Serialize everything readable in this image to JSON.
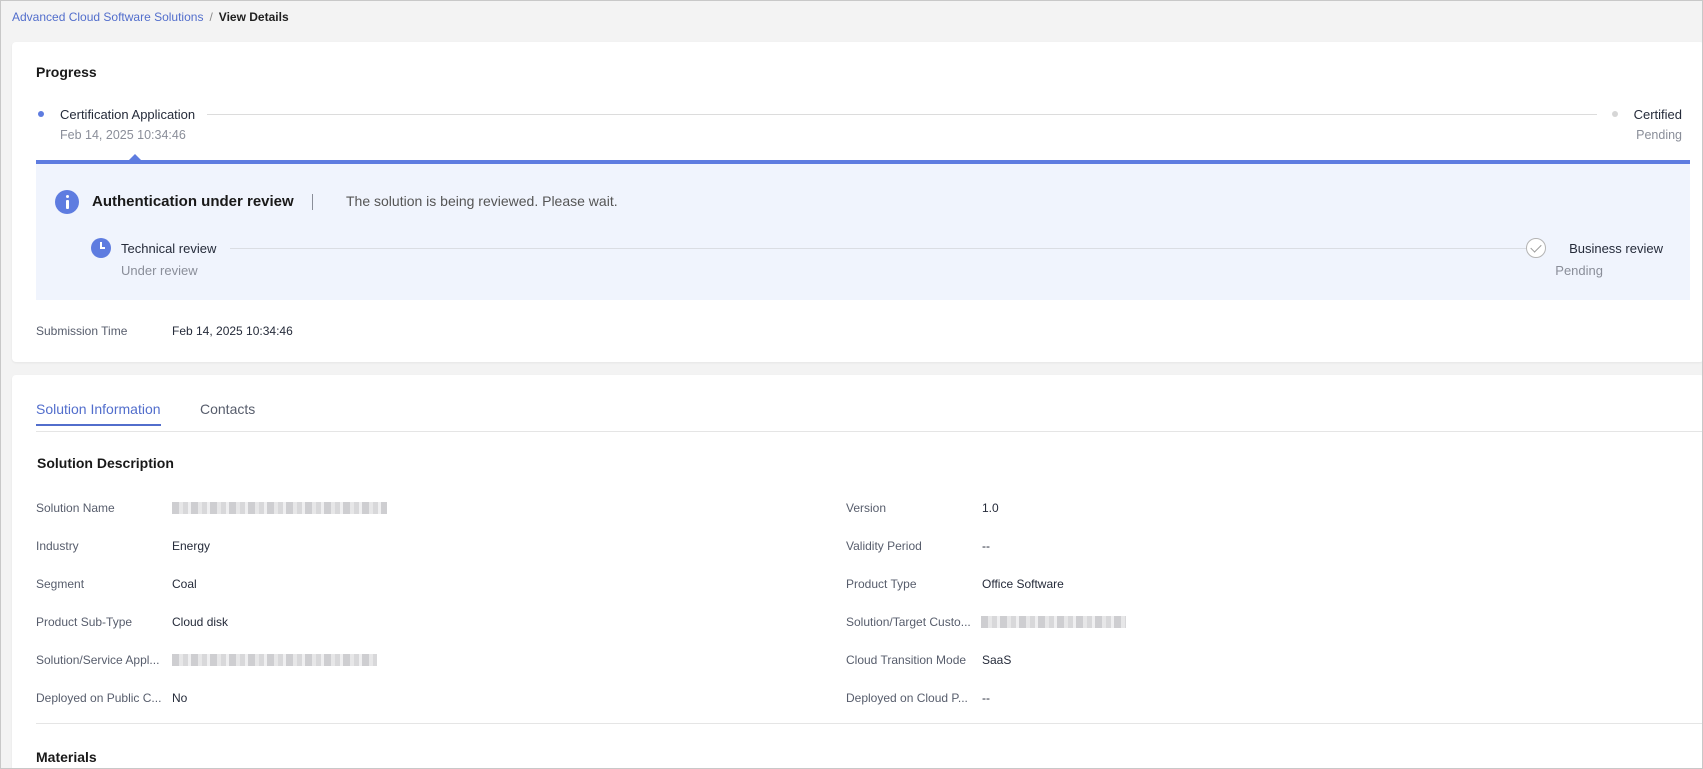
{
  "breadcrumb": {
    "parent": "Advanced Cloud Software Solutions",
    "separator": "/",
    "current": "View Details"
  },
  "progress": {
    "title": "Progress",
    "steps": [
      {
        "title": "Certification Application",
        "subtitle": "Feb 14, 2025 10:34:46",
        "state": "active"
      },
      {
        "title": "Certified",
        "subtitle": "Pending",
        "state": "pending"
      }
    ],
    "review": {
      "title": "Authentication under review",
      "message": "The solution is being reviewed. Please wait.",
      "substeps": [
        {
          "title": "Technical review",
          "status": "Under review"
        },
        {
          "title": "Business review",
          "status": "Pending"
        }
      ]
    },
    "submission_time_label": "Submission Time",
    "submission_time_value": "Feb 14, 2025 10:34:46"
  },
  "tabs": [
    {
      "label": "Solution Information",
      "active": true
    },
    {
      "label": "Contacts",
      "active": false
    }
  ],
  "solution_description": {
    "title": "Solution Description",
    "left": [
      {
        "label": "Solution Name",
        "value": ""
      },
      {
        "label": "Industry",
        "value": "Energy"
      },
      {
        "label": "Segment",
        "value": "Coal"
      },
      {
        "label": "Product Sub-Type",
        "value": "Cloud disk"
      },
      {
        "label": "Solution/Service Appl...",
        "value": ""
      },
      {
        "label": "Deployed on Public C...",
        "value": "No"
      }
    ],
    "right": [
      {
        "label": "Version",
        "value": "1.0"
      },
      {
        "label": "Validity Period",
        "value": "--"
      },
      {
        "label": "Product Type",
        "value": "Office Software"
      },
      {
        "label": "Solution/Target Custo...",
        "value": ""
      },
      {
        "label": "Cloud Transition Mode",
        "value": "SaaS"
      },
      {
        "label": "Deployed on Cloud P...",
        "value": "--"
      }
    ]
  },
  "materials_title": "Materials",
  "colors": {
    "accent": "#5e7ce0",
    "link": "#526ecc",
    "review_bg": "#f0f4fd"
  },
  "icons": [
    "info-icon",
    "clock-icon",
    "check-circle-icon"
  ]
}
